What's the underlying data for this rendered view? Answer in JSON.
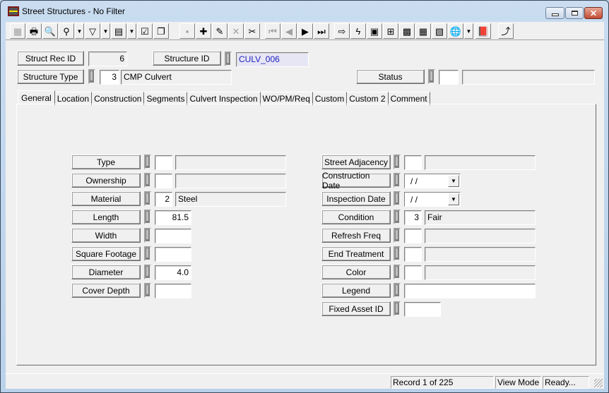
{
  "window": {
    "title": "Street Structures - No Filter",
    "controls": {
      "minimize": "—",
      "maximize": "□",
      "close": "✕"
    }
  },
  "toolbar": {
    "buttons": [
      {
        "name": "form-view",
        "glyph": "▦",
        "enabled": false
      },
      {
        "name": "print",
        "glyph": "🖶",
        "enabled": true
      },
      {
        "name": "preview",
        "glyph": "🔍",
        "enabled": true
      },
      {
        "name": "find",
        "glyph": "⚲",
        "enabled": true,
        "dropdown": true
      },
      {
        "name": "filter",
        "glyph": "▽",
        "enabled": true,
        "dropdown": true
      },
      {
        "name": "report",
        "glyph": "▤",
        "enabled": true,
        "dropdown": true
      },
      {
        "name": "properties",
        "glyph": "☑",
        "enabled": true
      },
      {
        "name": "copy-record",
        "glyph": "❐",
        "enabled": true
      },
      {
        "name": "save",
        "glyph": "▪",
        "enabled": false
      },
      {
        "name": "add-record",
        "glyph": "✚",
        "enabled": true
      },
      {
        "name": "edit",
        "glyph": "✎",
        "enabled": true
      },
      {
        "name": "delete",
        "glyph": "✕",
        "enabled": false
      },
      {
        "name": "cut",
        "glyph": "✂",
        "enabled": true
      },
      {
        "name": "first-record",
        "glyph": "⏮",
        "enabled": false
      },
      {
        "name": "previous-record",
        "glyph": "◀",
        "enabled": false
      },
      {
        "name": "next-record",
        "glyph": "▶",
        "enabled": true
      },
      {
        "name": "last-record",
        "glyph": "⏭",
        "enabled": true
      },
      {
        "name": "goto",
        "glyph": "⇨",
        "enabled": true
      },
      {
        "name": "quick-action",
        "glyph": "ϟ",
        "enabled": true
      },
      {
        "name": "related-records",
        "glyph": "▣",
        "enabled": true
      },
      {
        "name": "hierarchy",
        "glyph": "⊞",
        "enabled": true
      },
      {
        "name": "equipment",
        "glyph": "▩",
        "enabled": true
      },
      {
        "name": "calculator",
        "glyph": "▦",
        "enabled": true
      },
      {
        "name": "map-layers",
        "glyph": "▧",
        "enabled": true
      },
      {
        "name": "gis-globe",
        "glyph": "🌐",
        "enabled": true,
        "dropdown": true
      },
      {
        "name": "help-book",
        "glyph": "📕",
        "enabled": true
      },
      {
        "name": "exit",
        "glyph": "⤴",
        "enabled": true
      }
    ]
  },
  "header": {
    "struct_rec_id": {
      "label": "Struct Rec ID",
      "value": "6"
    },
    "structure_id": {
      "label": "Structure ID",
      "value": "CULV_006"
    },
    "structure_type": {
      "label": "Structure Type",
      "code": "3",
      "description": "CMP Culvert"
    },
    "status": {
      "label": "Status",
      "code": "",
      "description": ""
    }
  },
  "tabs": [
    {
      "label": "General",
      "active": true
    },
    {
      "label": "Location",
      "active": false
    },
    {
      "label": "Construction",
      "active": false
    },
    {
      "label": "Segments",
      "active": false
    },
    {
      "label": "Culvert Inspection",
      "active": false
    },
    {
      "label": "WO/PM/Req",
      "active": false
    },
    {
      "label": "Custom",
      "active": false
    },
    {
      "label": "Custom 2",
      "active": false
    },
    {
      "label": "Comment",
      "active": false
    }
  ],
  "general": {
    "left": [
      {
        "label": "Type",
        "code": "",
        "description": ""
      },
      {
        "label": "Ownership",
        "code": "",
        "description": ""
      },
      {
        "label": "Material",
        "code": "2",
        "description": "Steel"
      },
      {
        "label": "Length",
        "value": "81.5"
      },
      {
        "label": "Width",
        "value": ""
      },
      {
        "label": "Square Footage",
        "value": ""
      },
      {
        "label": "Diameter",
        "value": "4.0"
      },
      {
        "label": "Cover Depth",
        "value": ""
      }
    ],
    "right": [
      {
        "label": "Street Adjacency",
        "code": "",
        "description": ""
      },
      {
        "label": "Construction Date",
        "date": " /  /"
      },
      {
        "label": "Inspection Date",
        "date": " /  /"
      },
      {
        "label": "Condition",
        "code": "3",
        "description": "Fair"
      },
      {
        "label": "Refresh Freq",
        "code": "",
        "description": ""
      },
      {
        "label": "End Treatment",
        "code": "",
        "description": ""
      },
      {
        "label": "Color",
        "code": "",
        "description": ""
      },
      {
        "label": "Legend",
        "value": ""
      },
      {
        "label": "Fixed Asset ID",
        "value": ""
      }
    ]
  },
  "statusbar": {
    "record": "Record 1 of 225",
    "mode": "View Mode",
    "state": "Ready..."
  }
}
